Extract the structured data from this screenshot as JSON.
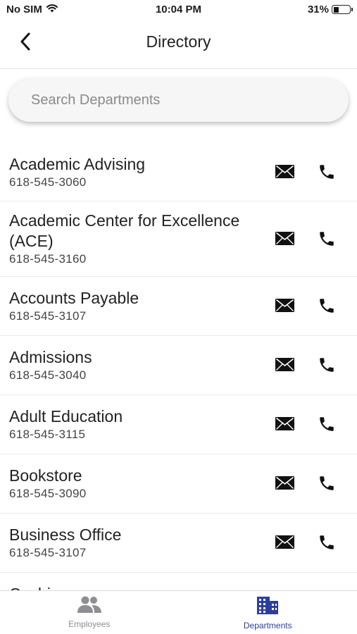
{
  "status_bar": {
    "carrier": "No SIM",
    "time": "10:04 PM",
    "battery_pct": "31%",
    "battery_level": 0.31
  },
  "nav": {
    "title": "Directory"
  },
  "search": {
    "placeholder": "Search Departments"
  },
  "departments": [
    {
      "name": "Academic Advising",
      "phone": "618-545-3060"
    },
    {
      "name": "Academic Center for Excellence (ACE)",
      "phone": "618-545-3160"
    },
    {
      "name": "Accounts Payable",
      "phone": "618-545-3107"
    },
    {
      "name": "Admissions",
      "phone": "618-545-3040"
    },
    {
      "name": "Adult Education",
      "phone": "618-545-3115"
    },
    {
      "name": "Bookstore",
      "phone": "618-545-3090"
    },
    {
      "name": "Business Office",
      "phone": "618-545-3107"
    },
    {
      "name": "Cashier",
      "phone": ""
    }
  ],
  "tabs": [
    {
      "label": "Employees",
      "icon": "people-icon",
      "active": false
    },
    {
      "label": "Departments",
      "icon": "building-icon",
      "active": true
    }
  ],
  "colors": {
    "active_tab": "#2d3e9a",
    "inactive_tab": "#8e8e93"
  }
}
